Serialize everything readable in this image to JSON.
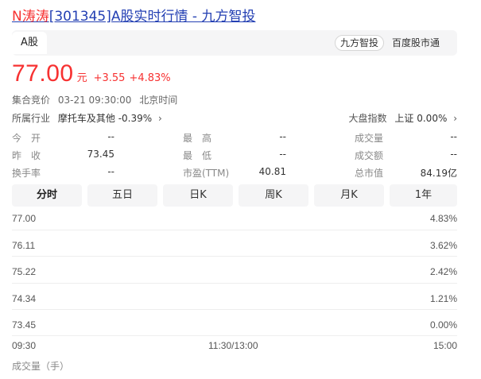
{
  "header": {
    "title_name": "N涛涛",
    "title_rest": "[301345]A股实时行情 - 九方智投"
  },
  "tabbar": {
    "tab": "A股",
    "source_tag": "九方智投",
    "source_link": "百度股市通"
  },
  "quote": {
    "price": "77.00",
    "unit": "元",
    "change": "+3.55",
    "change_pct": "+4.83%"
  },
  "status": {
    "phase": "集合竞价",
    "time": "03-21 09:30:00",
    "tz": "北京时间"
  },
  "industry": {
    "label": "所属行业",
    "name": "摩托车及其他",
    "pct": "-0.39%"
  },
  "market": {
    "label": "大盘指数",
    "name": "上证",
    "pct": "0.00%"
  },
  "stats": {
    "open": {
      "label": "今　开",
      "value": "--"
    },
    "prev_close": {
      "label": "昨　收",
      "value": "73.45"
    },
    "turnover": {
      "label": "换手率",
      "value": "--"
    },
    "high": {
      "label": "最　高",
      "value": "--"
    },
    "low": {
      "label": "最　低",
      "value": "--"
    },
    "pe": {
      "label": "市盈(TTM)",
      "value": "40.81"
    },
    "volume": {
      "label": "成交量",
      "value": "--"
    },
    "amount": {
      "label": "成交额",
      "value": "--"
    },
    "market_cap": {
      "label": "总市值",
      "value": "84.19亿"
    }
  },
  "periods": [
    "分时",
    "五日",
    "日K",
    "周K",
    "月K",
    "1年"
  ],
  "chart": {
    "y_prices": [
      "77.00",
      "76.11",
      "75.22",
      "74.34",
      "73.45"
    ],
    "y_pcts": [
      "4.83%",
      "3.62%",
      "2.42%",
      "1.21%",
      "0.00%"
    ],
    "x_labels": [
      "09:30",
      "11:30/13:00",
      "15:00"
    ],
    "volume_label": "成交量（手）"
  },
  "colors": {
    "up": "#f73131",
    "link": "#2440b3"
  }
}
